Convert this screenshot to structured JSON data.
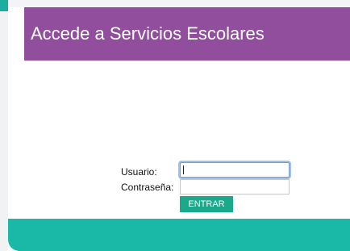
{
  "header": {
    "title": "Accede a Servicios Escolares"
  },
  "login_form": {
    "username_label": "Usuario:",
    "username_value": "",
    "password_label": "Contraseña:",
    "password_value": "",
    "submit_label": "ENTRAR"
  },
  "colors": {
    "header_bg": "#914e9c",
    "button_bg": "#1aa98a",
    "footer_bg": "#1ab8a7",
    "accent_strip": "#1aada0"
  }
}
